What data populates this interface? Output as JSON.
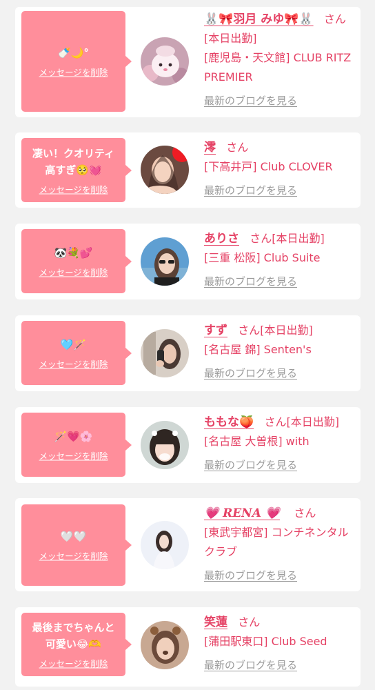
{
  "delete_label": "メッセージを削除",
  "blog_label": "最新のブログを見る",
  "honorific": "さん",
  "colors": {
    "background": "#f2f2f2",
    "card": "#ffffff",
    "bubble": "#ff8e9b",
    "accent_text": "#e54265",
    "link_gray": "#9a9a9a"
  },
  "items": [
    {
      "message": "🍼🌙°",
      "name": "🐰🎀羽月 みゆ🎀🐰",
      "status": "[本日出勤]",
      "shop": "[鹿児島・天文館] CLUB RITZ PREMIER",
      "avatar_icon": "plush-toy-avatar"
    },
    {
      "message": "凄い！クオリティ\n高すぎ🥺💓",
      "name": "澪",
      "status": "",
      "shop": "[下高井戸] Club CLOVER",
      "avatar_icon": "selfie-avatar"
    },
    {
      "message": "🐼💐💕",
      "name": "ありさ",
      "status": "[本日出勤]",
      "shop": "[三重 松阪] Club Suite",
      "avatar_icon": "sunglasses-avatar"
    },
    {
      "message": "🩵🪄",
      "name": "すず",
      "status": "[本日出勤]",
      "shop": "[名古屋 錦] Senten's",
      "avatar_icon": "mirror-selfie-avatar"
    },
    {
      "message": "🪄💗🌸",
      "name": "ももな🍑",
      "status": "[本日出勤]",
      "shop": "[名古屋 大曽根] with",
      "avatar_icon": "bangs-portrait-avatar"
    },
    {
      "message": "🤍🤍",
      "name": "💗 𝑹𝑬𝑵𝑨 💗",
      "status": "",
      "shop": "[東武宇都宮] コンチネンタルクラブ",
      "avatar_icon": "white-background-portrait-avatar"
    },
    {
      "message": "最後までちゃんと\n可愛い😂🫶",
      "name": "笑蓮",
      "status": "",
      "shop": "[蒲田駅東口] Club Seed",
      "avatar_icon": "filter-selfie-avatar"
    }
  ]
}
